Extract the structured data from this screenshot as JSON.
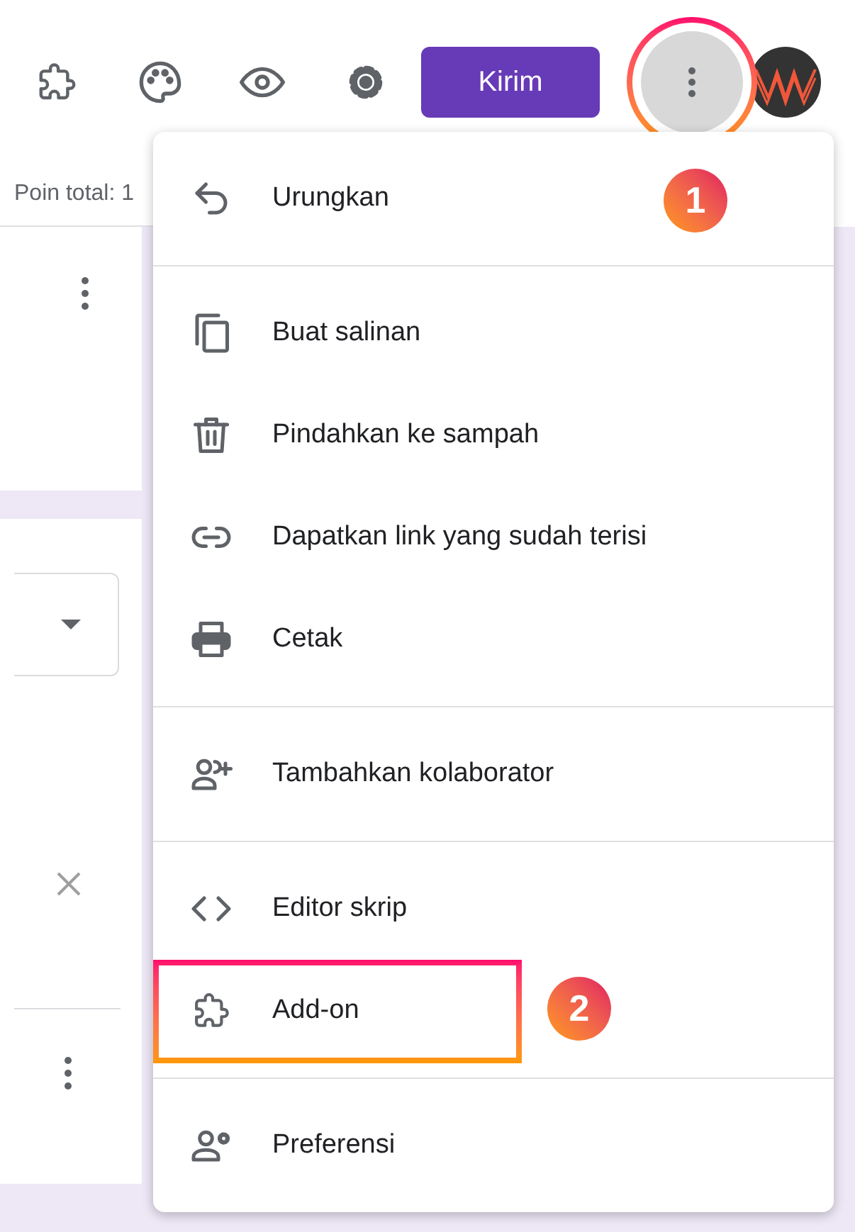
{
  "toolbar": {
    "send_button": "Kirim",
    "more_button": {
      "highlighted": true
    }
  },
  "points_text": "Poin total: 1",
  "menu": {
    "groups": [
      [
        {
          "label": "Urungkan",
          "highlighted": false
        }
      ],
      [
        {
          "label": "Buat salinan",
          "highlighted": false
        },
        {
          "label": "Pindahkan ke sampah",
          "highlighted": false
        },
        {
          "label": "Dapatkan link yang sudah terisi",
          "highlighted": false
        },
        {
          "label": "Cetak",
          "highlighted": false
        }
      ],
      [
        {
          "label": "Tambahkan kolaborator",
          "highlighted": false
        }
      ],
      [
        {
          "label": "Editor skrip",
          "highlighted": false
        },
        {
          "label": "Add-on",
          "highlighted": true
        }
      ],
      [
        {
          "label": "Preferensi",
          "highlighted": false
        }
      ]
    ]
  },
  "step_badges": [
    "1",
    "2"
  ]
}
